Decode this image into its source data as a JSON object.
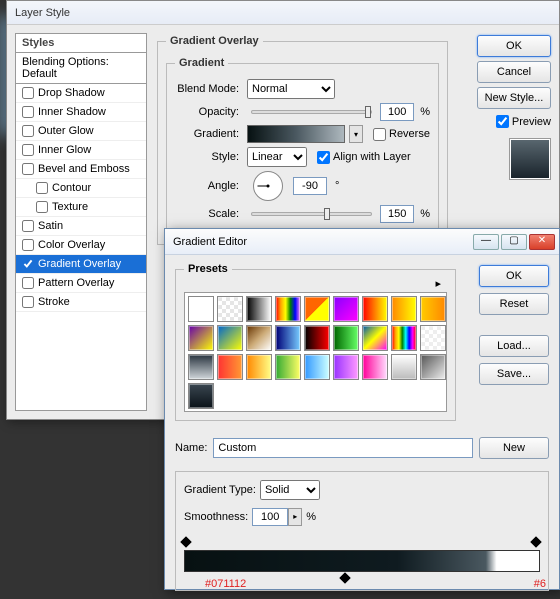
{
  "layer_style": {
    "title": "Layer Style",
    "styles_header": "Styles",
    "blending_options": "Blending Options: Default",
    "items": [
      {
        "label": "Drop Shadow",
        "checked": false
      },
      {
        "label": "Inner Shadow",
        "checked": false
      },
      {
        "label": "Outer Glow",
        "checked": false
      },
      {
        "label": "Inner Glow",
        "checked": false
      },
      {
        "label": "Bevel and Emboss",
        "checked": false
      },
      {
        "label": "Contour",
        "checked": false,
        "indent": true
      },
      {
        "label": "Texture",
        "checked": false,
        "indent": true
      },
      {
        "label": "Satin",
        "checked": false
      },
      {
        "label": "Color Overlay",
        "checked": false
      },
      {
        "label": "Gradient Overlay",
        "checked": true,
        "selected": true
      },
      {
        "label": "Pattern Overlay",
        "checked": false
      },
      {
        "label": "Stroke",
        "checked": false
      }
    ],
    "group_title": "Gradient Overlay",
    "subgroup_title": "Gradient",
    "blend_mode_label": "Blend Mode:",
    "blend_mode_value": "Normal",
    "opacity_label": "Opacity:",
    "opacity_value": "100",
    "pct": "%",
    "gradient_label": "Gradient:",
    "reverse_label": "Reverse",
    "style_label": "Style:",
    "style_value": "Linear",
    "align_label": "Align with Layer",
    "angle_label": "Angle:",
    "angle_value": "-90",
    "deg": "°",
    "scale_label": "Scale:",
    "scale_value": "150",
    "ok": "OK",
    "cancel": "Cancel",
    "new_style": "New Style...",
    "preview": "Preview"
  },
  "gradient_editor": {
    "title": "Gradient Editor",
    "presets_label": "Presets",
    "ok": "OK",
    "reset": "Reset",
    "load": "Load...",
    "save": "Save...",
    "name_label": "Name:",
    "name_value": "Custom",
    "new": "New",
    "gt_label": "Gradient Type:",
    "gt_value": "Solid",
    "smooth_label": "Smoothness:",
    "smooth_value": "100",
    "pct": "%",
    "hex_left": "#071112",
    "hex_right": "#6"
  },
  "preset_gradients": [
    "linear-gradient(#fff,#fff)",
    "repeating-conic-gradient(#fff 0 25%,#e5e5e5 0 50%) 50%/8px 8px",
    "linear-gradient(90deg,#000,#fff)",
    "linear-gradient(90deg,red,orange,yellow,green,blue,violet)",
    "linear-gradient(135deg,#f60,#f60 50%,transparent 50%),linear-gradient(#ff0,#ff0)",
    "linear-gradient(135deg,#80f,#f0f)",
    "linear-gradient(90deg,#f00,#ff0)",
    "linear-gradient(90deg,#f80,#ff0)",
    "linear-gradient(90deg,#fc0,#f80)",
    "linear-gradient(135deg,#60a,#ff0)",
    "linear-gradient(135deg,#06c,#ff0)",
    "linear-gradient(135deg,#630,#ca7,#fff)",
    "linear-gradient(90deg,#007,#7cf)",
    "linear-gradient(90deg,#000,#f00)",
    "linear-gradient(90deg,#060,#6f6)",
    "linear-gradient(135deg,#05a,#ff0,#f0f)",
    "linear-gradient(90deg,red,orange,yellow,green,cyan,blue,magenta,red)",
    "repeating-conic-gradient(#fff 0 25%,#eee 0 50%) 50%/8px 8px",
    "linear-gradient(#2a3540,#d0d6da)",
    "linear-gradient(90deg,#f33,#f93)",
    "linear-gradient(90deg,#f80,#ff8)",
    "linear-gradient(90deg,#3a3,#ff6)",
    "linear-gradient(90deg,#39f,#cff)",
    "linear-gradient(90deg,#93f,#f9f)",
    "linear-gradient(90deg,#f09,#fdf)",
    "linear-gradient(#fff,#bbb)",
    "linear-gradient(135deg,#555,#eee)",
    "linear-gradient(#3a4650,#0a1218)"
  ]
}
